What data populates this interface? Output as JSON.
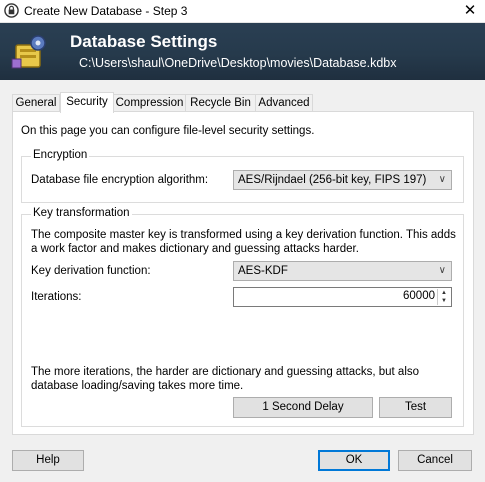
{
  "window": {
    "title": "Create New Database - Step 3",
    "close_symbol": "✕"
  },
  "banner": {
    "title": "Database Settings",
    "path": "C:\\Users\\shaul\\OneDrive\\Desktop\\movies\\Database.kdbx"
  },
  "tabs": [
    {
      "label": "General"
    },
    {
      "label": "Security",
      "active": true
    },
    {
      "label": "Compression"
    },
    {
      "label": "Recycle Bin"
    },
    {
      "label": "Advanced"
    }
  ],
  "security": {
    "intro": "On this page you can configure file-level security settings.",
    "encryption": {
      "group_label": "Encryption",
      "algorithm_label": "Database file encryption algorithm:",
      "algorithm_value": "AES/Rijndael (256-bit key, FIPS 197)"
    },
    "key_transformation": {
      "group_label": "Key transformation",
      "description": "The composite master key is transformed using a key derivation function. This adds a work factor and makes dictionary and guessing attacks harder.",
      "kdf_label": "Key derivation function:",
      "kdf_value": "AES-KDF",
      "iterations_label": "Iterations:",
      "iterations_value": "60000",
      "note": "The more iterations, the harder are dictionary and guessing attacks, but also database loading/saving takes more time.",
      "delay_button": "1 Second Delay",
      "test_button": "Test"
    }
  },
  "buttons": {
    "help": "Help",
    "ok": "OK",
    "cancel": "Cancel"
  },
  "icons": {
    "app": "keepass-lock-icon",
    "banner": "database-settings-icon",
    "dropdown": "chevron-down-icon",
    "spinner": "spin-arrows-icon"
  }
}
